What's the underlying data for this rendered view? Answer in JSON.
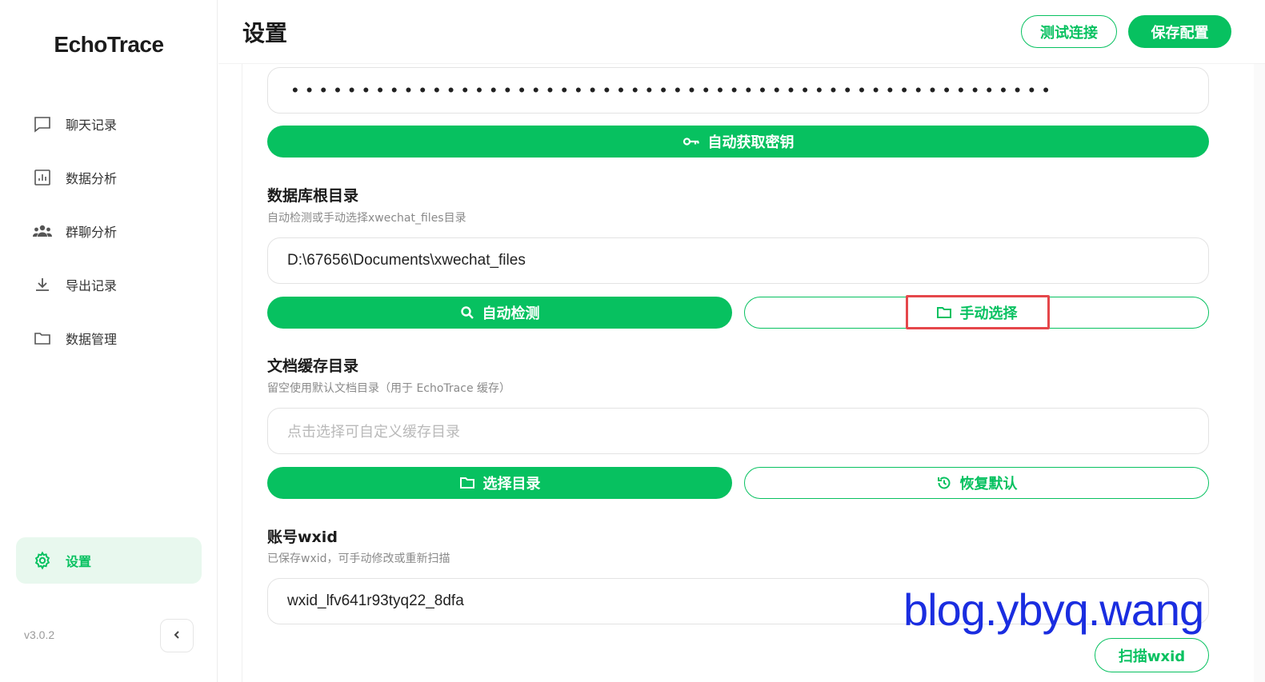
{
  "sidebar": {
    "brand": "EchoTrace",
    "items": [
      {
        "label": "聊天记录",
        "icon": "chat-icon"
      },
      {
        "label": "数据分析",
        "icon": "chart-icon"
      },
      {
        "label": "群聊分析",
        "icon": "group-icon"
      },
      {
        "label": "导出记录",
        "icon": "download-icon"
      },
      {
        "label": "数据管理",
        "icon": "folder-icon"
      }
    ],
    "active_item": {
      "label": "设置",
      "icon": "gear-icon"
    },
    "version": "v3.0.2"
  },
  "header": {
    "title": "设置",
    "test_button": "测试连接",
    "save_button": "保存配置"
  },
  "key_section": {
    "key_value": "••••••••••••••••••••••••••••••••••••••••••••••••••••••",
    "auto_key_button": "自动获取密钥"
  },
  "db_section": {
    "title": "数据库根目录",
    "subtitle": "自动检测或手动选择xwechat_files目录",
    "path_value": "D:\\67656\\Documents\\xwechat_files",
    "auto_detect_button": "自动检测",
    "manual_select_button": "手动选择"
  },
  "cache_section": {
    "title": "文档缓存目录",
    "subtitle": "留空使用默认文档目录（用于 EchoTrace 缓存）",
    "placeholder": "点击选择可自定义缓存目录",
    "choose_button": "选择目录",
    "restore_button": "恢复默认"
  },
  "wxid_section": {
    "title": "账号wxid",
    "subtitle": "已保存wxid，可手动修改或重新扫描",
    "wxid_value": "wxid_lfv641r93tyq22_8dfa",
    "scan_button": "扫描wxid"
  },
  "watermark": "blog.ybyq.wang",
  "colors": {
    "accent": "#07c160",
    "accent_light": "#e8f8ee",
    "highlight": "#e5474b",
    "watermark": "#1a2de0"
  }
}
